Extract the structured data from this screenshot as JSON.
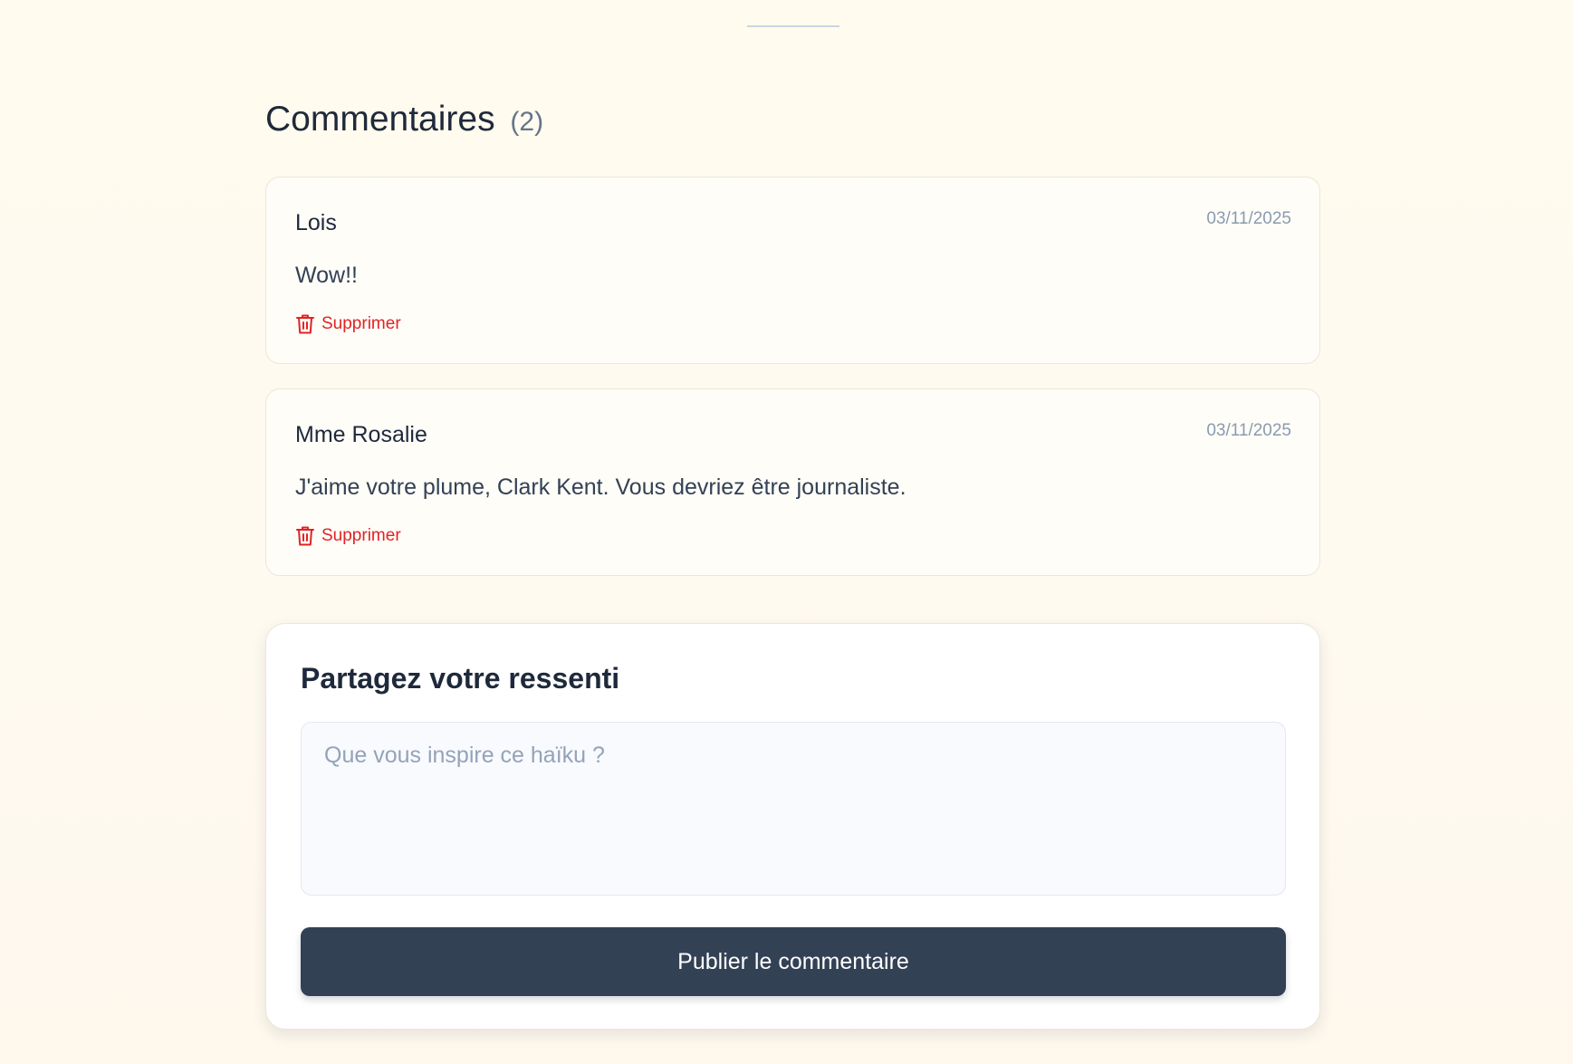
{
  "comments_section": {
    "title": "Commentaires",
    "count": "(2)",
    "comments": [
      {
        "author": "Lois",
        "date": "03/11/2025",
        "text": "Wow!!",
        "delete_label": "Supprimer"
      },
      {
        "author": "Mme Rosalie",
        "date": "03/11/2025",
        "text": "J'aime votre plume, Clark Kent. Vous devriez être journaliste.",
        "delete_label": "Supprimer"
      }
    ]
  },
  "comment_form": {
    "title": "Partagez votre ressenti",
    "placeholder": "Que vous inspire ce haïku ?",
    "value": "",
    "submit_label": "Publier le commentaire"
  },
  "icons": {
    "delete": "trash-icon"
  },
  "colors": {
    "background": "#fffbee",
    "primary_button": "#334155",
    "delete_red": "#e02424",
    "muted_text": "#8a9bb0"
  }
}
